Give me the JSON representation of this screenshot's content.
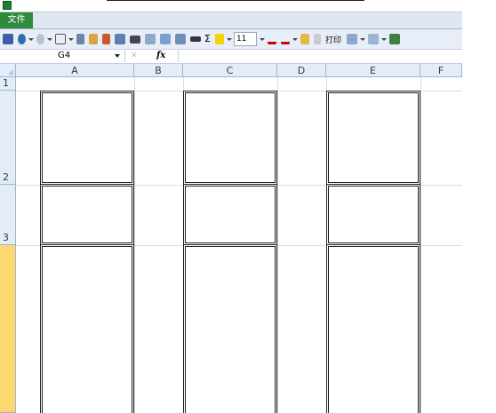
{
  "ribbon": {
    "file_tab": "文件"
  },
  "quick_access": {
    "font_size": "11",
    "print_label": "打印",
    "icons": [
      "save-icon",
      "undo-icon",
      "redo-icon",
      "borders-icon",
      "format-painter-icon",
      "print-preview-icon",
      "brush-icon",
      "table-icon",
      "align-icon",
      "chart-icon",
      "sort-icon",
      "filter-icon",
      "merge-icon",
      "sum-icon",
      "fill-color-icon",
      "font-color-icon",
      "font-color-alt-icon",
      "copy-icon",
      "print-icon",
      "paste-icon",
      "shape-icon",
      "picture-icon"
    ],
    "sum_symbol": "Σ"
  },
  "formula_bar": {
    "name_box": "G4",
    "fx_label": "fx",
    "formula": ""
  },
  "sheet": {
    "columns": [
      "A",
      "B",
      "C",
      "D",
      "E",
      "F"
    ],
    "rows": [
      "1",
      "2",
      "3",
      ""
    ],
    "selected_row_index": 3
  },
  "colors": {
    "file_tab": "#2e8b3e",
    "header_bg": "#e4ecf7",
    "selected_header": "#fcd970",
    "gridline": "#dadcdd",
    "border": "#222222"
  }
}
